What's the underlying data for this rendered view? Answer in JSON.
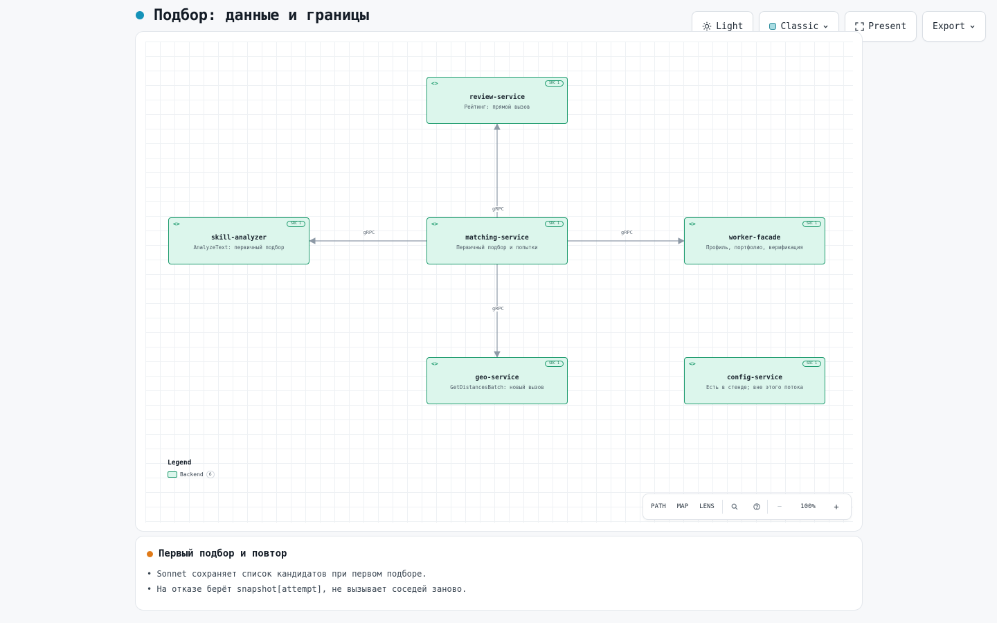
{
  "header": {
    "title": "Подбор: данные и границы",
    "accent": "#1593b9"
  },
  "toolbar": {
    "theme_label": "Light",
    "style_label": "Classic",
    "present_label": "Present",
    "export_label": "Export"
  },
  "diagram": {
    "nodes": [
      {
        "id": "review",
        "title": "review-service",
        "subtitle": "Рейтинг: прямой вызов",
        "badge": "SRC 1"
      },
      {
        "id": "skill",
        "title": "skill-analyzer",
        "subtitle": "AnalyzeText: первичный подбор",
        "badge": "SRC 1"
      },
      {
        "id": "matching",
        "title": "matching-service",
        "subtitle": "Первичный подбор и попытки",
        "badge": "SRC 1"
      },
      {
        "id": "worker",
        "title": "worker-facade",
        "subtitle": "Профиль, портфолио, верификация",
        "badge": "SRC 1"
      },
      {
        "id": "geo",
        "title": "geo-service",
        "subtitle": "GetDistancesBatch: новый вызов",
        "badge": "SRC 1"
      },
      {
        "id": "config",
        "title": "config-service",
        "subtitle": "Есть в стенде; вне этого потока",
        "badge": "SRC 1"
      }
    ],
    "edges": [
      {
        "from": "matching",
        "to": "review",
        "label": "gRPC"
      },
      {
        "from": "matching",
        "to": "skill",
        "label": "gRPC"
      },
      {
        "from": "matching",
        "to": "worker",
        "label": "gRPC"
      },
      {
        "from": "matching",
        "to": "geo",
        "label": "gRPC"
      }
    ],
    "node_icon": "code-brackets-icon",
    "colors": {
      "node_fill": "#dcf6ec",
      "node_border": "#1b9a6c",
      "edge": "#8d99a6"
    }
  },
  "legend": {
    "title": "Legend",
    "items": [
      {
        "label": "Backend",
        "count": "6"
      }
    ]
  },
  "controls": {
    "path_label": "PATH",
    "map_label": "MAP",
    "lens_label": "LENS",
    "zoom_out_label": "—",
    "zoom_value": "100%",
    "zoom_in_label": "+"
  },
  "notes": {
    "title": "Первый подбор и повтор",
    "accent": "#e07a18",
    "items": [
      "• Sonnet сохраняет список кандидатов при первом подборе.",
      "• На отказе берёт snapshot[attempt], не вызывает соседей заново."
    ]
  }
}
